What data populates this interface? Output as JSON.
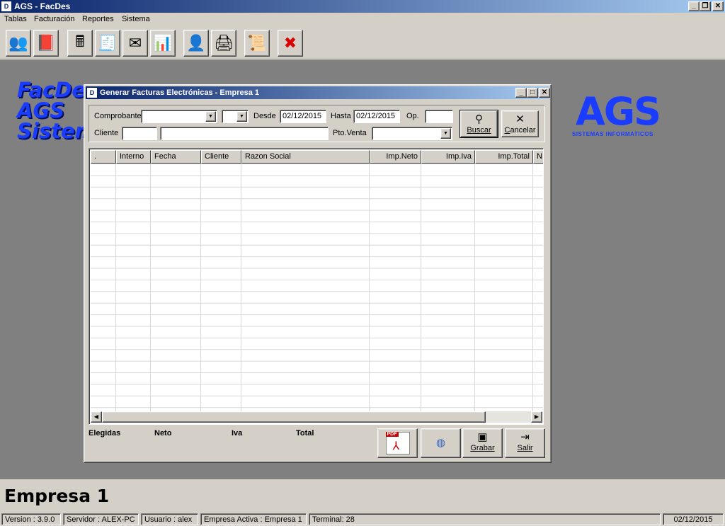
{
  "window": {
    "title": "AGS - FacDes",
    "icon_text": "D"
  },
  "menu": [
    "Tablas",
    "Facturación",
    "Reportes",
    "Sistema"
  ],
  "toolbar": [
    {
      "name": "users-icon",
      "glyph": "👥"
    },
    {
      "name": "book-icon",
      "glyph": "📕"
    },
    {
      "name": "calculator-icon",
      "glyph": "🖩"
    },
    {
      "name": "invoice-icon",
      "glyph": "🧾"
    },
    {
      "name": "envelope-icon",
      "glyph": "✉"
    },
    {
      "name": "bar-chart-icon",
      "glyph": "📊"
    },
    {
      "name": "user-doc-icon",
      "glyph": "👤"
    },
    {
      "name": "user-print-icon",
      "glyph": "🖨"
    },
    {
      "name": "certificate-icon",
      "glyph": "📜"
    },
    {
      "name": "exit-icon",
      "glyph": "✖"
    }
  ],
  "desktop": {
    "brand_lines": [
      "FacDes",
      "AGS",
      "Sistem"
    ],
    "logo": "AGS",
    "logo_sub": "SISTEMAS INFORMATICOS"
  },
  "dialog": {
    "title": "Generar Facturas Electrónicas  - Empresa 1",
    "filters": {
      "comprobante_label": "Comprobante",
      "desde_label": "Desde",
      "desde_value": "02/12/2015",
      "hasta_label": "Hasta",
      "hasta_value": "02/12/2015",
      "op_label": "Op.",
      "cliente_label": "Cliente",
      "pto_venta_label": "Pto.Venta"
    },
    "buscar_label": "Buscar",
    "cancelar_label": "Cancelar",
    "grid": {
      "columns": [
        ".",
        "Interno",
        "Fecha",
        "Cliente",
        "Razon Social",
        "Imp.Neto",
        "Imp.Iva",
        "Imp.Total",
        "N"
      ]
    },
    "totals": {
      "elegidas": "Elegidas",
      "neto": "Neto",
      "iva": "Iva",
      "total": "Total"
    },
    "grabar_label": "Grabar",
    "salir_label": "Salir",
    "pdf_label": "PDF"
  },
  "empresa_big": "Empresa 1",
  "status": {
    "version": "Version : 3.9.0",
    "servidor": "Servidor : ALEX-PC",
    "usuario": "Usuario : alex",
    "empresa": "Empresa Activa : Empresa 1",
    "terminal": "Terminal: 28",
    "date": "02/12/2015"
  }
}
